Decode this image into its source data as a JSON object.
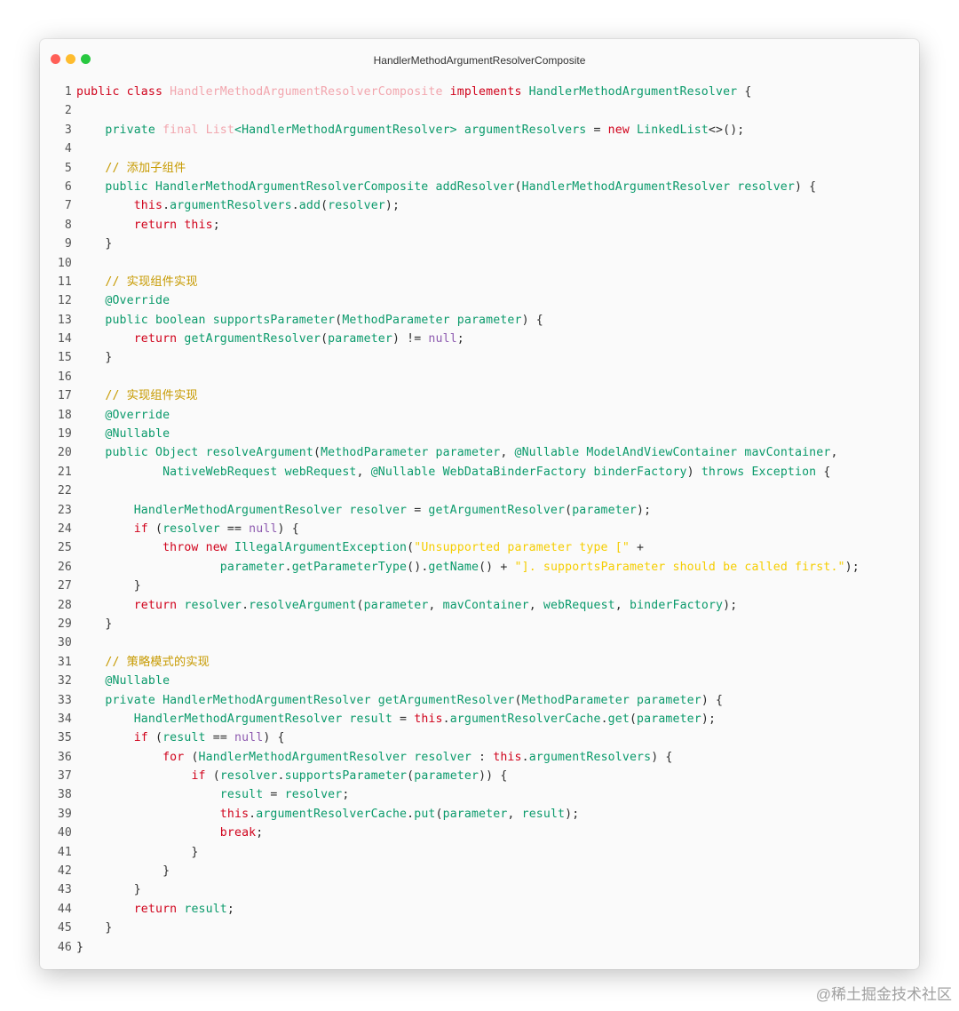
{
  "window": {
    "title": "HandlerMethodArgumentResolverComposite"
  },
  "colors": {
    "keyword": "#d0021b",
    "type": "#0a9a6b",
    "comment": "#c79a00",
    "string": "#f5cd00",
    "faded": "#f2a6ae",
    "null": "#8e5bb0"
  },
  "code_lines": [
    [
      [
        "kw",
        "public class "
      ],
      [
        "fade",
        "HandlerMethodArgumentResolverComposite"
      ],
      [
        "kw",
        " implements "
      ],
      [
        "ty",
        "HandlerMethodArgumentResolver"
      ],
      [
        "plain",
        " {"
      ]
    ],
    [],
    [
      [
        "plain",
        "    "
      ],
      [
        "ty",
        "private "
      ],
      [
        "fade",
        "final List"
      ],
      [
        "ty",
        "<HandlerMethodArgumentResolver> argumentResolvers"
      ],
      [
        "plain",
        " = "
      ],
      [
        "kw",
        "new "
      ],
      [
        "ty",
        "LinkedList"
      ],
      [
        "plain",
        "<>();"
      ]
    ],
    [],
    [
      [
        "plain",
        "    "
      ],
      [
        "cm",
        "// 添加子组件"
      ]
    ],
    [
      [
        "plain",
        "    "
      ],
      [
        "ty",
        "public HandlerMethodArgumentResolverComposite addResolver"
      ],
      [
        "plain",
        "("
      ],
      [
        "ty",
        "HandlerMethodArgumentResolver resolver"
      ],
      [
        "plain",
        ") {"
      ]
    ],
    [
      [
        "plain",
        "        "
      ],
      [
        "kw",
        "this"
      ],
      [
        "plain",
        "."
      ],
      [
        "ty",
        "argumentResolvers"
      ],
      [
        "plain",
        "."
      ],
      [
        "ty",
        "add"
      ],
      [
        "plain",
        "("
      ],
      [
        "ty",
        "resolver"
      ],
      [
        "plain",
        ");"
      ]
    ],
    [
      [
        "plain",
        "        "
      ],
      [
        "kw",
        "return this"
      ],
      [
        "plain",
        ";"
      ]
    ],
    [
      [
        "plain",
        "    }"
      ]
    ],
    [],
    [
      [
        "plain",
        "    "
      ],
      [
        "cm",
        "// 实现组件实现"
      ]
    ],
    [
      [
        "plain",
        "    "
      ],
      [
        "ty",
        "@Override"
      ]
    ],
    [
      [
        "plain",
        "    "
      ],
      [
        "ty",
        "public boolean supportsParameter"
      ],
      [
        "plain",
        "("
      ],
      [
        "ty",
        "MethodParameter parameter"
      ],
      [
        "plain",
        ") {"
      ]
    ],
    [
      [
        "plain",
        "        "
      ],
      [
        "kw",
        "return "
      ],
      [
        "ty",
        "getArgumentResolver"
      ],
      [
        "plain",
        "("
      ],
      [
        "ty",
        "parameter"
      ],
      [
        "plain",
        ") != "
      ],
      [
        "num",
        "null"
      ],
      [
        "plain",
        ";"
      ]
    ],
    [
      [
        "plain",
        "    }"
      ]
    ],
    [],
    [
      [
        "plain",
        "    "
      ],
      [
        "cm",
        "// 实现组件实现"
      ]
    ],
    [
      [
        "plain",
        "    "
      ],
      [
        "ty",
        "@Override"
      ]
    ],
    [
      [
        "plain",
        "    "
      ],
      [
        "ty",
        "@Nullable"
      ]
    ],
    [
      [
        "plain",
        "    "
      ],
      [
        "ty",
        "public Object resolveArgument"
      ],
      [
        "plain",
        "("
      ],
      [
        "ty",
        "MethodParameter parameter"
      ],
      [
        "plain",
        ", "
      ],
      [
        "ty",
        "@Nullable ModelAndViewContainer mavContainer"
      ],
      [
        "plain",
        ","
      ]
    ],
    [
      [
        "plain",
        "            "
      ],
      [
        "ty",
        "NativeWebRequest webRequest"
      ],
      [
        "plain",
        ", "
      ],
      [
        "ty",
        "@Nullable WebDataBinderFactory binderFactory"
      ],
      [
        "plain",
        ") "
      ],
      [
        "ty",
        "throws Exception"
      ],
      [
        "plain",
        " {"
      ]
    ],
    [],
    [
      [
        "plain",
        "        "
      ],
      [
        "ty",
        "HandlerMethodArgumentResolver resolver"
      ],
      [
        "plain",
        " = "
      ],
      [
        "ty",
        "getArgumentResolver"
      ],
      [
        "plain",
        "("
      ],
      [
        "ty",
        "parameter"
      ],
      [
        "plain",
        ");"
      ]
    ],
    [
      [
        "plain",
        "        "
      ],
      [
        "kw",
        "if"
      ],
      [
        "plain",
        " ("
      ],
      [
        "ty",
        "resolver"
      ],
      [
        "plain",
        " == "
      ],
      [
        "num",
        "null"
      ],
      [
        "plain",
        ") {"
      ]
    ],
    [
      [
        "plain",
        "            "
      ],
      [
        "kw",
        "throw new "
      ],
      [
        "ty",
        "IllegalArgumentException"
      ],
      [
        "plain",
        "("
      ],
      [
        "str",
        "\"Unsupported parameter type [\""
      ],
      [
        "plain",
        " +"
      ]
    ],
    [
      [
        "plain",
        "                    "
      ],
      [
        "ty",
        "parameter"
      ],
      [
        "plain",
        "."
      ],
      [
        "ty",
        "getParameterType"
      ],
      [
        "plain",
        "()."
      ],
      [
        "ty",
        "getName"
      ],
      [
        "plain",
        "() + "
      ],
      [
        "str",
        "\"]. supportsParameter should be called first.\""
      ],
      [
        "plain",
        ");"
      ]
    ],
    [
      [
        "plain",
        "        }"
      ]
    ],
    [
      [
        "plain",
        "        "
      ],
      [
        "kw",
        "return "
      ],
      [
        "ty",
        "resolver"
      ],
      [
        "plain",
        "."
      ],
      [
        "ty",
        "resolveArgument"
      ],
      [
        "plain",
        "("
      ],
      [
        "ty",
        "parameter"
      ],
      [
        "plain",
        ", "
      ],
      [
        "ty",
        "mavContainer"
      ],
      [
        "plain",
        ", "
      ],
      [
        "ty",
        "webRequest"
      ],
      [
        "plain",
        ", "
      ],
      [
        "ty",
        "binderFactory"
      ],
      [
        "plain",
        ");"
      ]
    ],
    [
      [
        "plain",
        "    }"
      ]
    ],
    [],
    [
      [
        "plain",
        "    "
      ],
      [
        "cm",
        "// 策略模式的实现"
      ]
    ],
    [
      [
        "plain",
        "    "
      ],
      [
        "ty",
        "@Nullable"
      ]
    ],
    [
      [
        "plain",
        "    "
      ],
      [
        "ty",
        "private HandlerMethodArgumentResolver getArgumentResolver"
      ],
      [
        "plain",
        "("
      ],
      [
        "ty",
        "MethodParameter parameter"
      ],
      [
        "plain",
        ") {"
      ]
    ],
    [
      [
        "plain",
        "        "
      ],
      [
        "ty",
        "HandlerMethodArgumentResolver result"
      ],
      [
        "plain",
        " = "
      ],
      [
        "kw",
        "this"
      ],
      [
        "plain",
        "."
      ],
      [
        "ty",
        "argumentResolverCache"
      ],
      [
        "plain",
        "."
      ],
      [
        "ty",
        "get"
      ],
      [
        "plain",
        "("
      ],
      [
        "ty",
        "parameter"
      ],
      [
        "plain",
        ");"
      ]
    ],
    [
      [
        "plain",
        "        "
      ],
      [
        "kw",
        "if"
      ],
      [
        "plain",
        " ("
      ],
      [
        "ty",
        "result"
      ],
      [
        "plain",
        " == "
      ],
      [
        "num",
        "null"
      ],
      [
        "plain",
        ") {"
      ]
    ],
    [
      [
        "plain",
        "            "
      ],
      [
        "kw",
        "for"
      ],
      [
        "plain",
        " ("
      ],
      [
        "ty",
        "HandlerMethodArgumentResolver resolver"
      ],
      [
        "plain",
        " : "
      ],
      [
        "kw",
        "this"
      ],
      [
        "plain",
        "."
      ],
      [
        "ty",
        "argumentResolvers"
      ],
      [
        "plain",
        ") {"
      ]
    ],
    [
      [
        "plain",
        "                "
      ],
      [
        "kw",
        "if"
      ],
      [
        "plain",
        " ("
      ],
      [
        "ty",
        "resolver"
      ],
      [
        "plain",
        "."
      ],
      [
        "ty",
        "supportsParameter"
      ],
      [
        "plain",
        "("
      ],
      [
        "ty",
        "parameter"
      ],
      [
        "plain",
        ")) {"
      ]
    ],
    [
      [
        "plain",
        "                    "
      ],
      [
        "ty",
        "result"
      ],
      [
        "plain",
        " = "
      ],
      [
        "ty",
        "resolver"
      ],
      [
        "plain",
        ";"
      ]
    ],
    [
      [
        "plain",
        "                    "
      ],
      [
        "kw",
        "this"
      ],
      [
        "plain",
        "."
      ],
      [
        "ty",
        "argumentResolverCache"
      ],
      [
        "plain",
        "."
      ],
      [
        "ty",
        "put"
      ],
      [
        "plain",
        "("
      ],
      [
        "ty",
        "parameter"
      ],
      [
        "plain",
        ", "
      ],
      [
        "ty",
        "result"
      ],
      [
        "plain",
        ");"
      ]
    ],
    [
      [
        "plain",
        "                    "
      ],
      [
        "kw",
        "break"
      ],
      [
        "plain",
        ";"
      ]
    ],
    [
      [
        "plain",
        "                }"
      ]
    ],
    [
      [
        "plain",
        "            }"
      ]
    ],
    [
      [
        "plain",
        "        }"
      ]
    ],
    [
      [
        "plain",
        "        "
      ],
      [
        "kw",
        "return "
      ],
      [
        "ty",
        "result"
      ],
      [
        "plain",
        ";"
      ]
    ],
    [
      [
        "plain",
        "    }"
      ]
    ],
    [
      [
        "plain",
        "}"
      ]
    ]
  ],
  "watermark": "@稀土掘金技术社区"
}
